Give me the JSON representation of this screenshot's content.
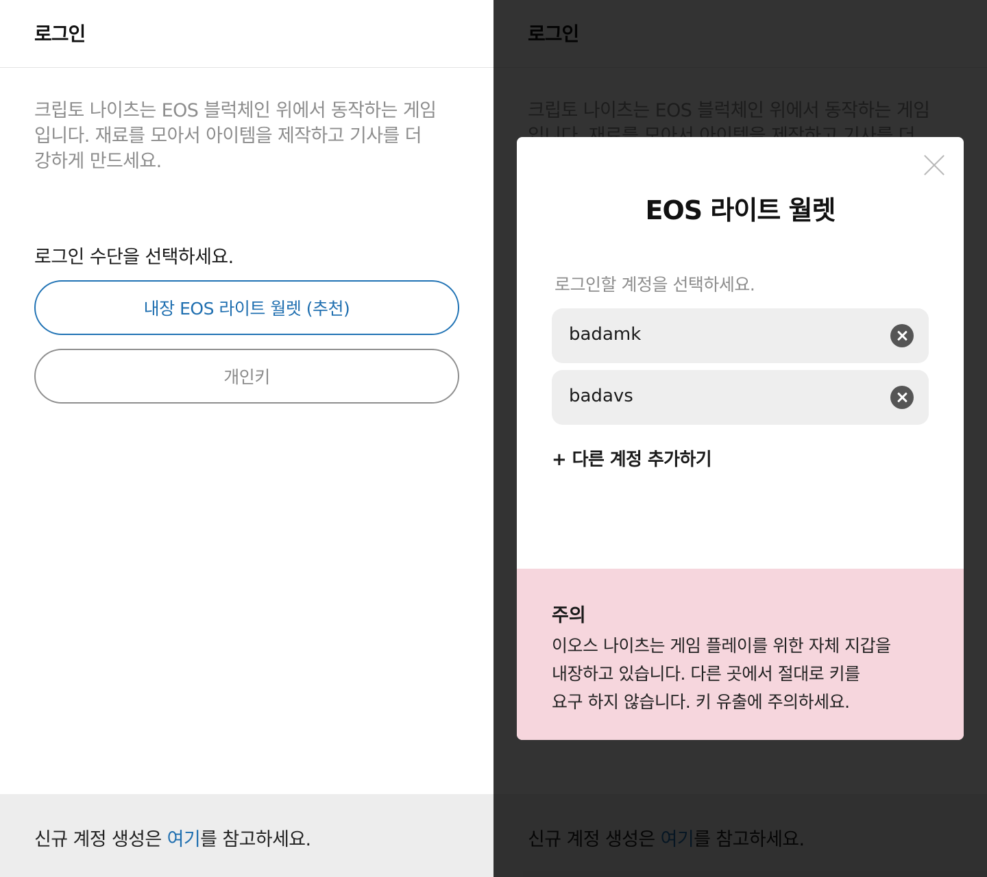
{
  "login_screen": {
    "header_title": "로그인",
    "intro_lines": [
      "크립토 나이츠는 EOS 블럭체인 위에서 동작하는 게임",
      "입니다. 재료를 모아서 아이템을 제작하고 기사를 더",
      "강하게 만드세요."
    ],
    "choose_method": "로그인 수단을 선택하세요.",
    "builtin_wallet_button": "내장 EOS 라이트 월렛 (추천)",
    "private_key_button": "개인키",
    "footer": {
      "prefix": "신규 계정 생성은 ",
      "link": "여기",
      "suffix": "를 참고하세요."
    }
  },
  "wallet_modal": {
    "title": "EOS 라이트 월렛",
    "subtitle": "로그인할 계정을 선택하세요.",
    "accounts": [
      {
        "name": "badamk"
      },
      {
        "name": "badavs"
      }
    ],
    "add_account": "+ 다른 계정 추가하기",
    "warning": {
      "title": "주의",
      "lines": [
        "이오스 나이츠는 게임 플레이를 위한 자체 지갑을",
        "내장하고 있습니다. 다른 곳에서 절대로 키를",
        "요구 하지 않습니다. 키 유출에 주의하세요."
      ]
    }
  },
  "colors": {
    "accent_blue": "#1f6fb0",
    "warning_bg": "#f6d6dd",
    "footer_bg": "#ededed",
    "overlay": "#000000cc"
  }
}
